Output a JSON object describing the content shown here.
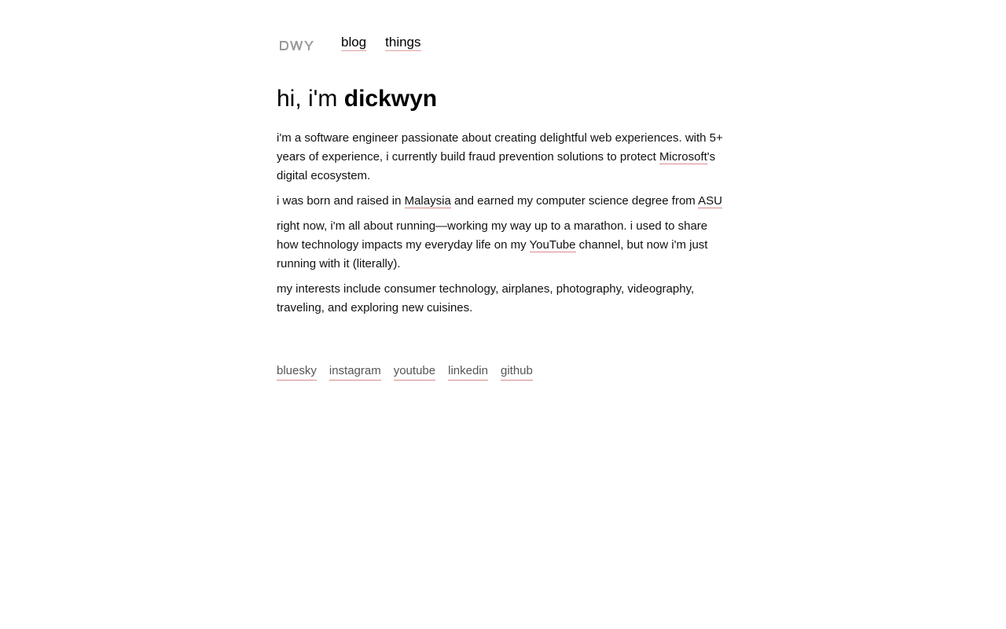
{
  "header": {
    "logo_text": "DWY",
    "nav": [
      {
        "label": "blog"
      },
      {
        "label": "things"
      }
    ]
  },
  "intro": {
    "greeting": "hi, i'm ",
    "name": "dickwyn"
  },
  "paragraphs": {
    "p1": {
      "text_before": "i'm a software engineer passionate about creating delightful web experiences. with 5+ years of experience, i currently build fraud prevention solutions to protect ",
      "link": "Microsoft",
      "text_after": "'s digital ecosystem."
    },
    "p2": {
      "text_before": "i was born and raised in ",
      "link1": "Malaysia",
      "text_mid": " and earned my computer science degree from ",
      "link2": "ASU"
    },
    "p3": {
      "text_before": "right now, i'm all about running—working my way up to a marathon. i used to share how technology impacts my everyday life on my ",
      "link": "YouTube",
      "text_after": " channel, but now i'm just running with it (literally)."
    },
    "p4": {
      "text": "my interests include consumer technology, airplanes, photography, videography, traveling, and exploring new cuisines."
    }
  },
  "social": [
    {
      "label": "bluesky"
    },
    {
      "label": "instagram"
    },
    {
      "label": "youtube"
    },
    {
      "label": "linkedin"
    },
    {
      "label": "github"
    }
  ],
  "colors": {
    "link_underline": "#d98a8a",
    "logo": "#999999",
    "text": "#111111"
  }
}
